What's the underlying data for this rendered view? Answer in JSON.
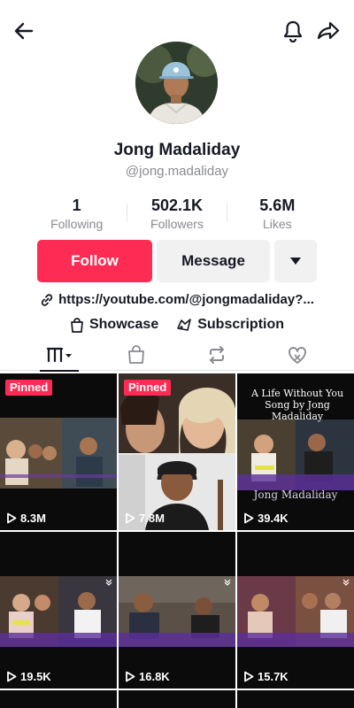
{
  "header": {
    "back_icon": "arrow-left-icon",
    "bell_icon": "bell-icon",
    "share_icon": "share-arrow-icon"
  },
  "profile": {
    "name": "Jong Madaliday",
    "handle": "@jong.madaliday"
  },
  "stats": [
    {
      "value": "1",
      "label": "Following"
    },
    {
      "value": "502.1K",
      "label": "Followers"
    },
    {
      "value": "5.6M",
      "label": "Likes"
    }
  ],
  "actions": {
    "follow": "Follow",
    "message": "Message",
    "more_icon": "triangle-down-icon"
  },
  "bio_link": "https://youtube.com/@jongmadaliday?...",
  "chips": {
    "showcase": "Showcase",
    "subscription": "Subscription"
  },
  "tabs": [
    "videos-grid-icon",
    "bag-icon",
    "repost-icon",
    "liked-heart-icon"
  ],
  "videos": [
    {
      "pinned": "Pinned",
      "views": "8.3M"
    },
    {
      "pinned": "Pinned",
      "views": "7.8M"
    },
    {
      "title": "A Life Without You Song by Jong Madaliday",
      "name": "Jong Madaliday",
      "views": "39.4K"
    },
    {
      "views": "19.5K"
    },
    {
      "views": "16.8K"
    },
    {
      "views": "15.7K"
    }
  ],
  "colors": {
    "accent": "#fe2c55",
    "text": "#161823",
    "muted": "#8a8b91",
    "button_bg": "#f1f1f2"
  }
}
